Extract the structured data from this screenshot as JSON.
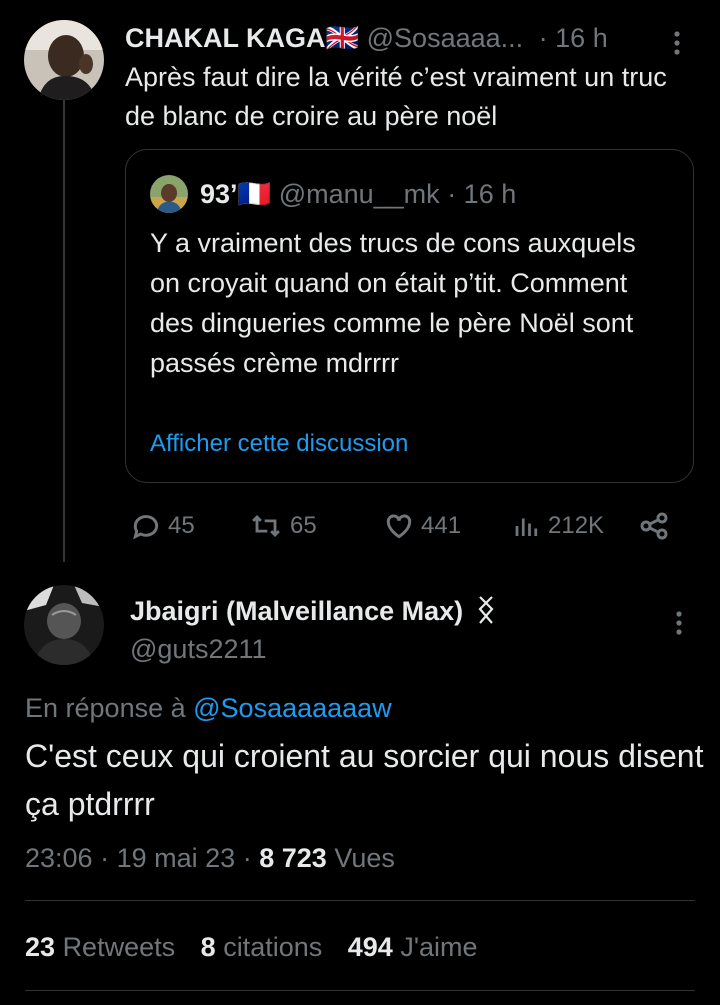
{
  "tweet1": {
    "author_name": "CHAKAL KAGA",
    "author_flag": "🇬🇧",
    "handle": "@Sosaaaa...",
    "time": "· 16 h",
    "text": "Après faut dire la vérité c’est vraiment un truc de blanc de croire au père noël",
    "quote": {
      "author_name": "93’",
      "author_flag": "🇫🇷",
      "handle": "@manu__mk",
      "time": "· 16 h",
      "text": "Y a vraiment des trucs de cons auxquels on croyait quand on était p’tit. Comment des dingueries comme le père Noël sont passés crème mdrrrr",
      "show_thread_label": "Afficher cette discussion"
    },
    "actions": {
      "replies": "45",
      "retweets": "65",
      "likes": "441",
      "views": "212K"
    }
  },
  "tweet2": {
    "author_name": "Jbaigri (Malveillance Max)",
    "handle": "@guts2211",
    "reply_prefix": "En réponse à",
    "reply_to": "@Sosaaaaaaaw",
    "text": "C'est ceux qui croient au sorcier qui nous disent ça ptdrrrr",
    "time": "23:06",
    "date": "19 mai 23",
    "views_count": "8 723",
    "views_label": "Vues",
    "stats": {
      "retweets_count": "23",
      "retweets_label": "Retweets",
      "quotes_count": "8",
      "quotes_label": "citations",
      "likes_count": "494",
      "likes_label": "J'aime"
    }
  },
  "colors": {
    "background": "#000000",
    "text": "#e7e9ea",
    "muted": "#71767b",
    "link": "#1d9bf0",
    "border": "#2f3336"
  }
}
